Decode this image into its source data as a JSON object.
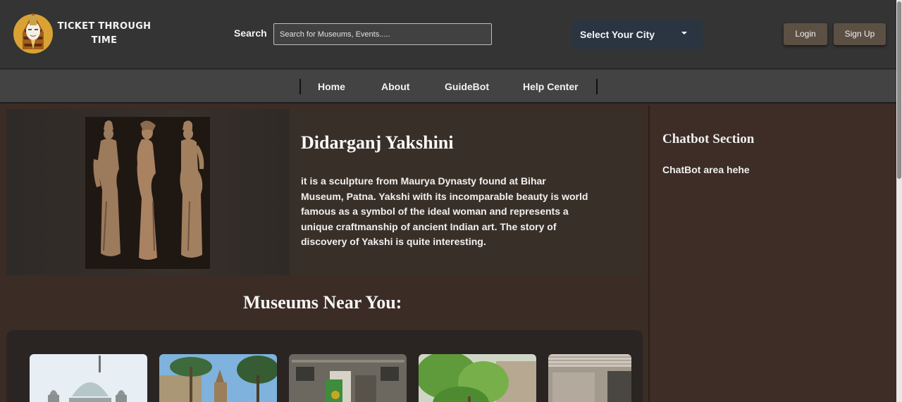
{
  "header": {
    "brand": "TICKET THROUGH TIME",
    "search_label": "Search",
    "search_placeholder": "Search for Museums, Events.....",
    "city_select": "Select Your City",
    "login": "Login",
    "signup": "Sign Up"
  },
  "nav": {
    "items": [
      "Home",
      "About",
      "GuideBot",
      "Help Center"
    ]
  },
  "feature": {
    "title": "Didarganj Yakshini",
    "description": "it is a sculpture from Maurya Dynasty found at Bihar Museum, Patna. Yakshi with its incomparable beauty is world famous as a symbol of the ideal woman and represents a unique craftmanship of ancient Indian art. The story of discovery of Yakshi is quite interesting."
  },
  "museums": {
    "title": "Museums Near You:",
    "cards": [
      {
        "icon": "dome-museum-image"
      },
      {
        "icon": "palm-museum-image"
      },
      {
        "icon": "facade-museum-image"
      },
      {
        "icon": "tree-museum-image"
      },
      {
        "icon": "building-museum-image"
      }
    ]
  },
  "chatbot": {
    "title": "Chatbot Section",
    "text": "ChatBot area hehe"
  },
  "colors": {
    "header_bg": "#343434",
    "nav_bg": "#434343",
    "body_bg": "#3b2c25",
    "button_bg": "#5c4f44",
    "city_bg": "#2a3541"
  }
}
